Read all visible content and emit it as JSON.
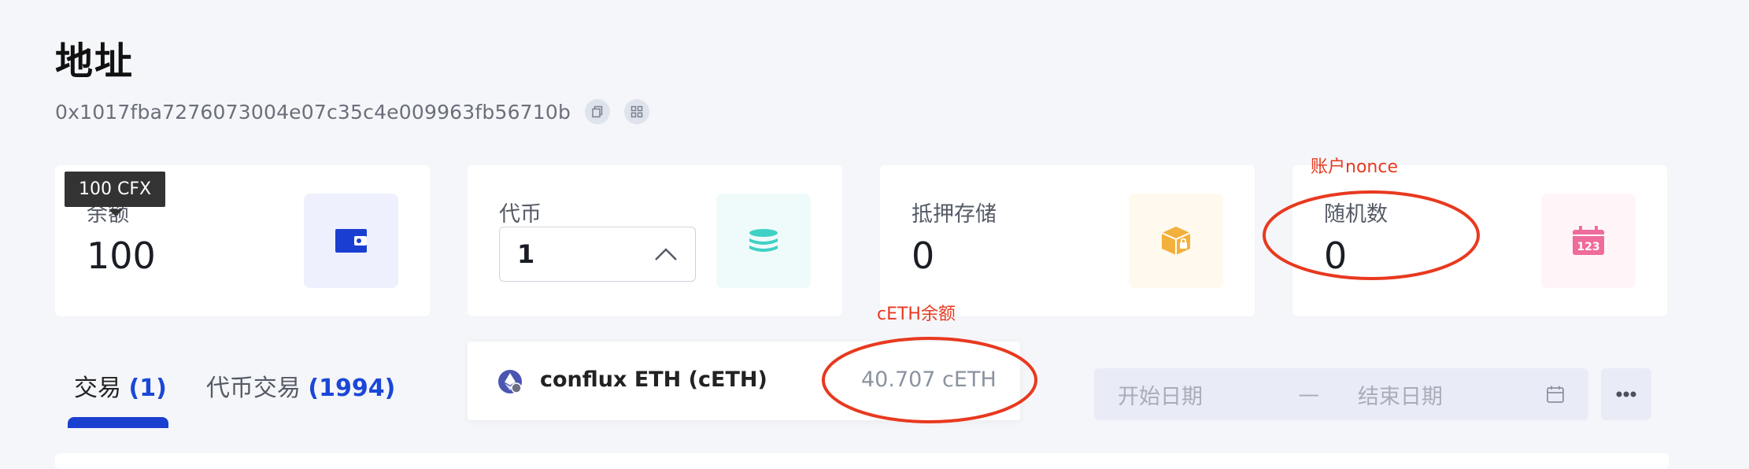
{
  "page": {
    "title": "地址",
    "address": "0x1017fba7276073004e07c35c4e009963fb56710b"
  },
  "cards": {
    "balance": {
      "label": "余额",
      "value": "100",
      "tooltip": "100 CFX"
    },
    "tokens": {
      "label": "代币",
      "selected": "1"
    },
    "staking": {
      "label": "抵押存储",
      "value": "0"
    },
    "nonce": {
      "label": "随机数",
      "value": "0"
    }
  },
  "tabs": [
    {
      "label": "交易",
      "count": "(1)"
    },
    {
      "label": "代币交易",
      "count": "(1994)"
    }
  ],
  "token_popup": {
    "name": "conflux ETH (cETH)",
    "balance": "40.707 cETH"
  },
  "date_range": {
    "start_placeholder": "开始日期",
    "separator": "—",
    "end_placeholder": "结束日期"
  },
  "annotations": {
    "nonce_note": "账户nonce",
    "ceth_note": "cETH余额",
    "color": "#e8391f"
  },
  "colors": {
    "accent": "#1a47d6",
    "wallet_icon": "#1a3fd0",
    "token_icon": "#3fd1c4",
    "staking_icon": "#f2b13c",
    "nonce_icon": "#ee6b9c"
  }
}
